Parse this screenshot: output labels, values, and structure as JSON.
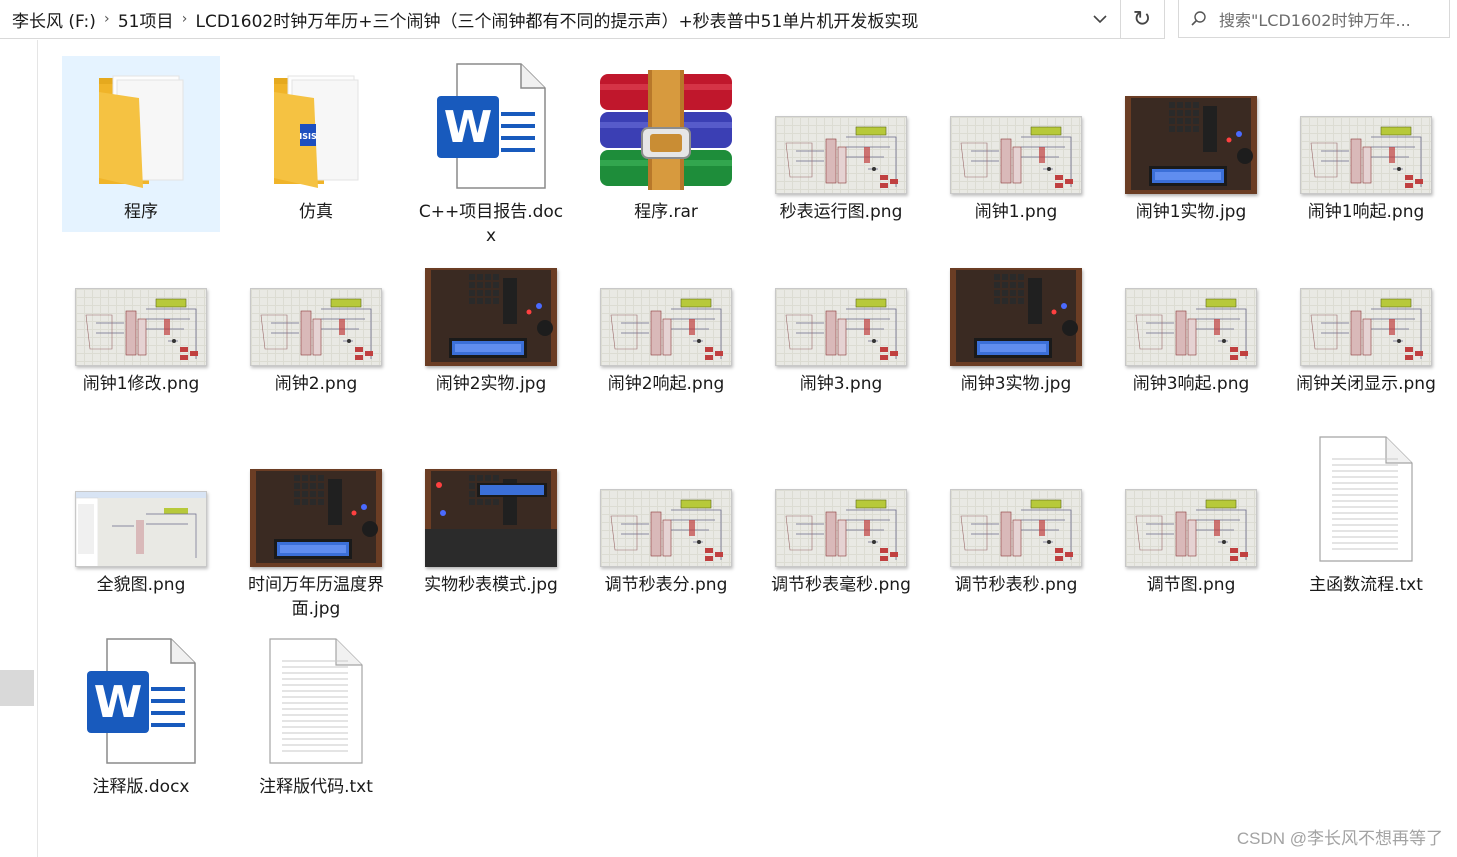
{
  "address": {
    "crumbs": [
      "李长风 (F:)",
      "51项目",
      "LCD1602时钟万年历+三个闹钟（三个闹钟都有不同的提示声）+秒表普中51单片机开发板实现"
    ],
    "separator": "›"
  },
  "search": {
    "placeholder": "搜索\"LCD1602时钟万年..."
  },
  "items": [
    {
      "label": "程序",
      "type": "folder",
      "selected": true
    },
    {
      "label": "仿真",
      "type": "folder-isis"
    },
    {
      "label": "C++项目报告.docx",
      "type": "word"
    },
    {
      "label": "程序.rar",
      "type": "rar"
    },
    {
      "label": "秒表运行图.png",
      "type": "schematic"
    },
    {
      "label": "闹钟1.png",
      "type": "schematic"
    },
    {
      "label": "闹钟1实物.jpg",
      "type": "photo"
    },
    {
      "label": "闹钟1响起.png",
      "type": "schematic"
    },
    {
      "label": "闹钟1修改.png",
      "type": "schematic"
    },
    {
      "label": "闹钟2.png",
      "type": "schematic"
    },
    {
      "label": "闹钟2实物.jpg",
      "type": "photo"
    },
    {
      "label": "闹钟2响起.png",
      "type": "schematic"
    },
    {
      "label": "闹钟3.png",
      "type": "schematic"
    },
    {
      "label": "闹钟3实物.jpg",
      "type": "photo"
    },
    {
      "label": "闹钟3响起.png",
      "type": "schematic"
    },
    {
      "label": "闹钟关闭显示.png",
      "type": "schematic"
    },
    {
      "label": "全貌图.png",
      "type": "screenshot"
    },
    {
      "label": "时间万年历温度界面.jpg",
      "type": "photo"
    },
    {
      "label": "实物秒表模式.jpg",
      "type": "photo-dark"
    },
    {
      "label": "调节秒表分.png",
      "type": "schematic"
    },
    {
      "label": "调节秒表毫秒.png",
      "type": "schematic"
    },
    {
      "label": "调节秒表秒.png",
      "type": "schematic"
    },
    {
      "label": "调节图.png",
      "type": "schematic"
    },
    {
      "label": "主函数流程.txt",
      "type": "text"
    },
    {
      "label": "注释版.docx",
      "type": "word"
    },
    {
      "label": "注释版代码.txt",
      "type": "text"
    }
  ],
  "colors": {
    "selection": "#e5f3ff",
    "folder": "#f5c242",
    "word_blue": "#185abd"
  },
  "watermark": "CSDN @李长风不想再等了"
}
